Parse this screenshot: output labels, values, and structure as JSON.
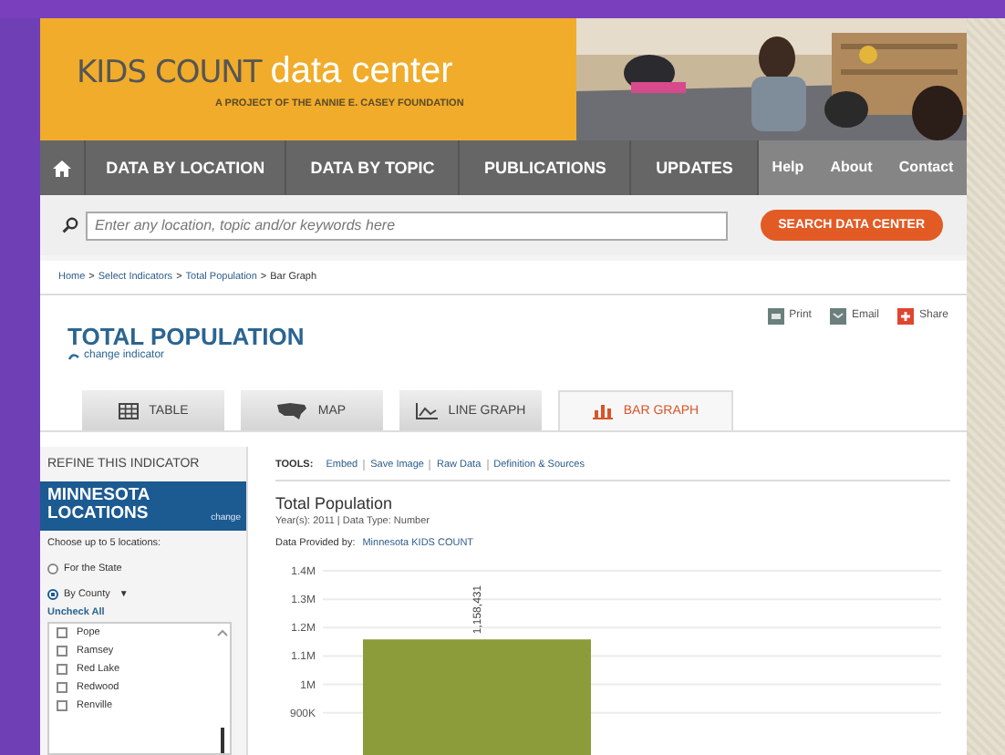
{
  "header": {
    "logo_primary": "KIDS COUNT",
    "logo_secondary": "data center",
    "tagline": "A PROJECT OF THE ANNIE E. CASEY FOUNDATION"
  },
  "nav": {
    "main": [
      "DATA BY LOCATION",
      "DATA BY TOPIC",
      "PUBLICATIONS",
      "UPDATES"
    ],
    "secondary": [
      "Help",
      "About",
      "Contact"
    ]
  },
  "search": {
    "placeholder": "Enter any location, topic and/or keywords here",
    "button": "SEARCH DATA CENTER"
  },
  "breadcrumb": {
    "separator": ">",
    "items": [
      "Home",
      "Select Indicators",
      "Total Population",
      "Bar Graph"
    ]
  },
  "indicator": {
    "title": "TOTAL POPULATION",
    "change_link": "change indicator",
    "actions": [
      {
        "label": "Print"
      },
      {
        "label": "Email"
      },
      {
        "label": "Share"
      }
    ]
  },
  "tabs": [
    {
      "label": "TABLE",
      "selected": false
    },
    {
      "label": "MAP",
      "selected": false
    },
    {
      "label": "LINE GRAPH",
      "selected": false
    },
    {
      "label": "BAR GRAPH",
      "selected": true
    }
  ],
  "sidebar": {
    "heading": "REFINE THIS INDICATOR",
    "location_title": "MINNESOTA LOCATIONS",
    "change": "change",
    "instruction": "Choose up to 5 locations:",
    "options": [
      {
        "label": "For the State",
        "selected": false
      },
      {
        "label": "By County",
        "selected": true,
        "dropdown": "▼"
      }
    ],
    "uncheck_all": "Uncheck All",
    "counties": [
      {
        "label": "Pope",
        "checked": false
      },
      {
        "label": "Ramsey",
        "checked": false
      },
      {
        "label": "Red Lake",
        "checked": false
      },
      {
        "label": "Redwood",
        "checked": false
      },
      {
        "label": "Renville",
        "checked": false
      }
    ]
  },
  "tools": {
    "label": "TOOLS:",
    "links": [
      "Embed",
      "Save Image",
      "Raw Data",
      "Definition & Sources"
    ]
  },
  "dataset": {
    "title": "Total Population",
    "meta": "Year(s): 2011 | Data Type: Number",
    "provider_label": "Data Provided by:",
    "provider": "Minnesota KIDS COUNT",
    "chart_data": {
      "type": "bar",
      "values": [
        1158431
      ],
      "grid": true,
      "ylim": [
        0,
        1400000
      ],
      "yticks": [
        {
          "value": 900000,
          "label": "900K"
        },
        {
          "value": 1000000,
          "label": "1M"
        },
        {
          "value": 1100000,
          "label": "1.1M"
        },
        {
          "value": 1200000,
          "label": "1.2M"
        },
        {
          "value": 1300000,
          "label": "1.3M"
        },
        {
          "value": 1400000,
          "label": "1.4M"
        }
      ],
      "value_labels": [
        "1,158,431"
      ]
    }
  }
}
